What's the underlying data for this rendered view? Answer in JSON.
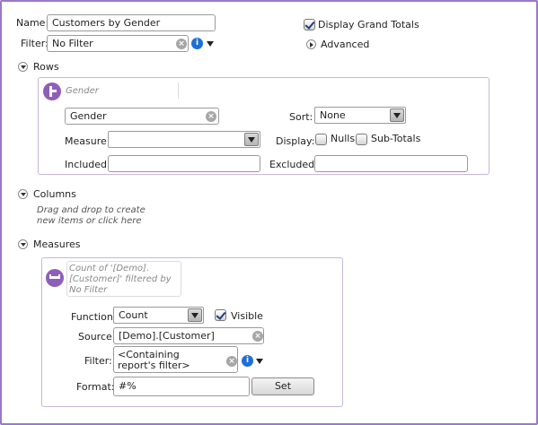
{
  "header": {
    "name_label": "Name:",
    "name_value": "Customers by Gender",
    "filter_label": "Filter:",
    "filter_value": "No Filter",
    "grand_totals_label": "Display Grand Totals",
    "grand_totals_checked": true,
    "advanced_label": "Advanced"
  },
  "rows": {
    "title": "Rows",
    "item_caption": "Gender",
    "field_value": "Gender",
    "sort_label": "Sort:",
    "sort_value": "None",
    "measure_label": "Measure:",
    "measure_value": "",
    "display_label": "Display:",
    "nulls_label": "Nulls",
    "subtotals_label": "Sub-Totals",
    "included_label": "Included:",
    "included_value": "",
    "excluded_label": "Excluded:",
    "excluded_value": ""
  },
  "columns": {
    "title": "Columns",
    "hint_line1": "Drag and drop to create",
    "hint_line2": "new items or click here"
  },
  "measures": {
    "title": "Measures",
    "caption_line1": "Count of '[Demo].",
    "caption_line2": "[Customer]' filtered by",
    "caption_line3": "No Filter",
    "function_label": "Function:",
    "function_value": "Count",
    "visible_label": "Visible",
    "visible_checked": true,
    "source_label": "Source:",
    "source_value": "[Demo].[Customer]",
    "filter_label": "Filter:",
    "filter_line1": "<Containing",
    "filter_line2": "report's filter>",
    "format_label": "Format:",
    "format_value": "#%",
    "set_button": "Set"
  },
  "colors": {
    "frame_border": "#9b78c6",
    "panel_border": "#c6b7dc",
    "badge_purple": "#8e5fb8",
    "info_blue": "#1d6fd6"
  }
}
